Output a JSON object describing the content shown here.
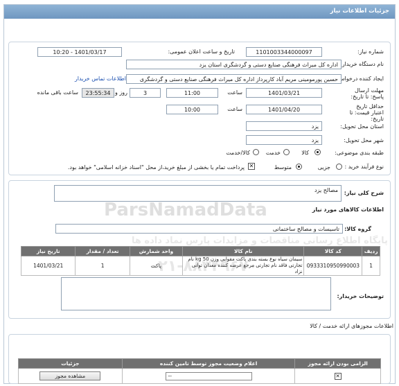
{
  "header": {
    "title": "جزئیات اطلاعات نیاز"
  },
  "need_number": {
    "label": "شماره نیاز:",
    "value": "1101003344000097"
  },
  "announce_date": {
    "label": "تاریخ و ساعت اعلان عمومی:",
    "value": "1401/03/17 - 10:20"
  },
  "buyer_org": {
    "label": "نام دستگاه خریدار:",
    "value": "اداره کل میراث فرهنگی  صنایع دستی و گردشگری استان یزد"
  },
  "requester": {
    "label": "ایجاد کننده درخواست:",
    "value": "حسین پورمومینی مریم آباد کارپرداز اداره کل میراث فرهنگی  صنایع دستی و گردشگری",
    "contact_link": "اطلاعات تماس خریدار"
  },
  "reply_deadline": {
    "label": "مهلت ارسال پاسخ: تا تاریخ:",
    "date": "1401/03/21",
    "time_label": "ساعت",
    "time": "11:00",
    "days": "3",
    "days_label": "روز و",
    "remaining": "23:55:34",
    "remaining_label": "ساعت باقی مانده"
  },
  "price_validity": {
    "label": "حداقل تاریخ اعتبار قیمت: تا تاریخ:",
    "date": "1401/04/20",
    "time_label": "ساعت",
    "time": "10:00"
  },
  "province": {
    "label": "استان محل تحویل:",
    "value": "یزد"
  },
  "city": {
    "label": "شهر محل تحویل:",
    "value": "یزد"
  },
  "category": {
    "label": "طبقه بندی موضوعی:",
    "options": [
      "کالا",
      "خدمت",
      "کالا/خدمت"
    ],
    "selected": "کالا"
  },
  "process": {
    "label": "نوع فرآیند خرید :",
    "options": [
      "جزیی",
      "متوسط"
    ],
    "selected": "متوسط",
    "treasury_note": "پرداخت تمام یا بخشی از مبلغ خرید،از محل \"اسناد خزانه اسلامی\" خواهد بود."
  },
  "summary": {
    "label": "شرح کلی نیاز:",
    "value": "مصالح یزد"
  },
  "goods_info": {
    "title": "اطلاعات کالاهای مورد نیاز"
  },
  "goods_group": {
    "label": "گروه کالا:",
    "value": "تاسیسات و مصالح ساختمانی"
  },
  "table": {
    "headers": [
      "ردیف",
      "کد کالا",
      "نام کالا",
      "واحد شمارش",
      "تعداد / مقدار",
      "تاریخ نیاز"
    ],
    "rows": [
      {
        "row": "1",
        "code": "0933310950990003",
        "name": "سیمان سیاه نوع بسته بندی پاکت مقوایی وزن 50 kg نام تجارتی فاقد نام تجارتی مرجع عرضه کننده معدان توانی نزاد",
        "unit": "پاکت",
        "qty": "1",
        "date": "1401/03/21"
      }
    ]
  },
  "buyer_notes": {
    "label": "توضیحات خریدار:",
    "value": ""
  },
  "permits": {
    "title": "اطلاعات مجوزهای ارائه خدمت / کالا",
    "headers": [
      "الزامی بودن ارائه مجوز",
      "اعلام وضعیت مجوز توسط تامین کننده",
      "جزئیات"
    ],
    "view_button": "مشاهده مجوز",
    "select_placeholder": "--"
  },
  "watermark": {
    "brand": "ParsNamadData",
    "persian": "پایگاه اطلاع رسانی مناقصات و مزایدات پارس نماد داده ها",
    "phone": "۰۲۱-۸۸۳۴۹۶۷۰"
  }
}
